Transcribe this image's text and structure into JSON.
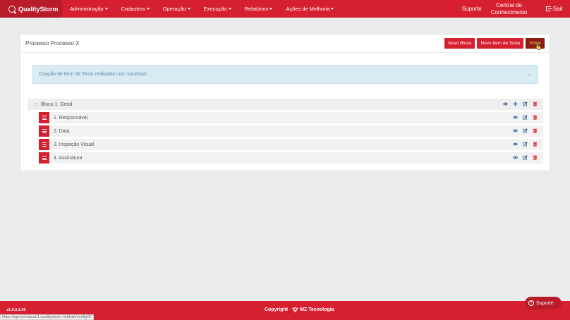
{
  "navbar": {
    "brand": "QualityStorm",
    "menu": [
      {
        "label": "Administração"
      },
      {
        "label": "Cadastros"
      },
      {
        "label": "Operação"
      },
      {
        "label": "Execução"
      },
      {
        "label": "Relatórios"
      },
      {
        "label": "Ações de Melhoria"
      }
    ],
    "suporte": "Suporte",
    "central_line1": "Central de",
    "central_line2": "Conhecimento",
    "sair": "Sair"
  },
  "panel": {
    "title": "Processo Processo X",
    "buttons": {
      "novo_bloco": "Novo Bloco",
      "novo_item": "Novo Item de Teste",
      "voltar": "Voltar"
    },
    "alert": {
      "message": "Criação de Item de Teste realizada com sucesso!",
      "close": "×"
    },
    "block": {
      "label": "Bloco 1. Geral"
    },
    "items": [
      {
        "label": "1. Responsável"
      },
      {
        "label": "2. Data"
      },
      {
        "label": "3. Inspeção Visual"
      },
      {
        "label": "4. Assinatura"
      }
    ]
  },
  "footer": {
    "version": "v1.0.0.1.00",
    "copyright": "Copyright",
    "company": "MZ Tecnologia",
    "status_url": "https://apresentacao1.qualitystorm.net/lstw/config/2/",
    "suporte": "Suporte"
  },
  "colors": {
    "primary": "#d7202f",
    "primary_dark": "#b71c28",
    "back_button": "#8a1c12",
    "alert_bg": "#d9ebf3",
    "icon_blue": "#2f5c8f"
  }
}
